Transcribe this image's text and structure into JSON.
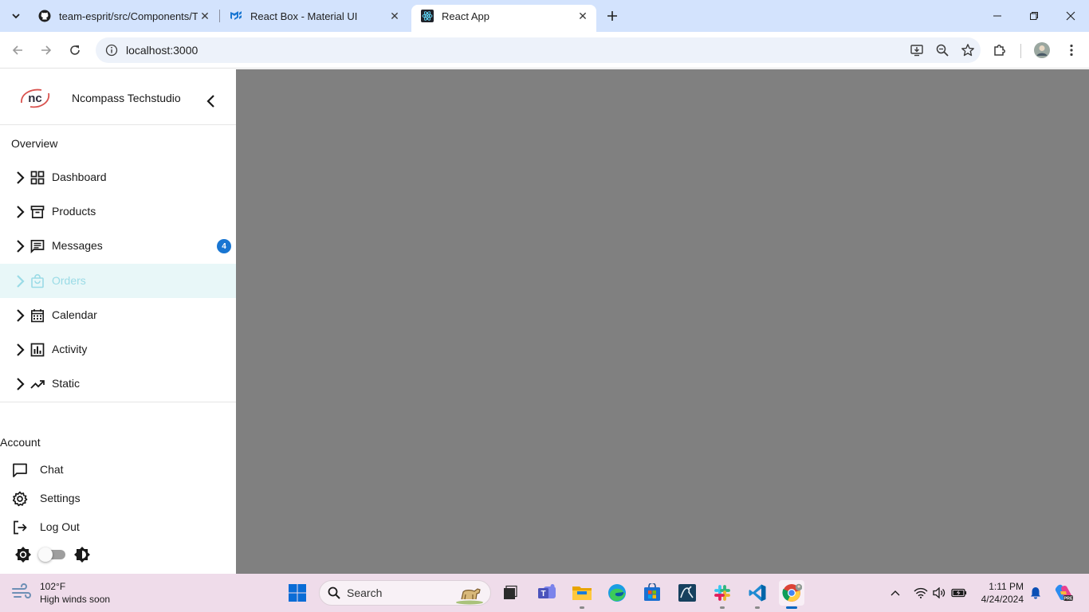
{
  "browser": {
    "tabs": [
      {
        "title": "team-esprit/src/Components/T",
        "favicon": "github-icon"
      },
      {
        "title": "React Box - Material UI",
        "favicon": "mui-icon"
      },
      {
        "title": "React App",
        "favicon": "react-icon",
        "active": true
      }
    ],
    "url": "localhost:3000"
  },
  "sidebar": {
    "brand": {
      "name": "Ncompass Techstudio",
      "logo_text": "nc"
    },
    "overview_title": "Overview",
    "nav_items": [
      {
        "label": "Dashboard",
        "icon": "dashboard-grid-icon"
      },
      {
        "label": "Products",
        "icon": "archive-box-icon"
      },
      {
        "label": "Messages",
        "icon": "message-icon",
        "badge": "4"
      },
      {
        "label": "Orders",
        "icon": "shopping-bag-icon",
        "selected": true
      },
      {
        "label": "Calendar",
        "icon": "calendar-icon"
      },
      {
        "label": "Activity",
        "icon": "bar-chart-icon"
      },
      {
        "label": "Static",
        "icon": "trending-up-icon"
      }
    ],
    "account_title": "Account",
    "account_items": [
      {
        "label": "Chat",
        "icon": "chat-bubble-icon"
      },
      {
        "label": "Settings",
        "icon": "gear-icon"
      },
      {
        "label": "Log Out",
        "icon": "logout-icon"
      }
    ],
    "theme_toggle": {
      "on": false
    }
  },
  "taskbar": {
    "weather": {
      "temp": "102°F",
      "desc": "High winds soon"
    },
    "search_label": "Search",
    "clock": {
      "time": "1:11 PM",
      "date": "4/24/2024"
    }
  },
  "colors": {
    "selected_bg": "#e8f7f8",
    "selected_text": "#9adbe6",
    "badge": "#1976d2",
    "overlay": "#808080"
  }
}
